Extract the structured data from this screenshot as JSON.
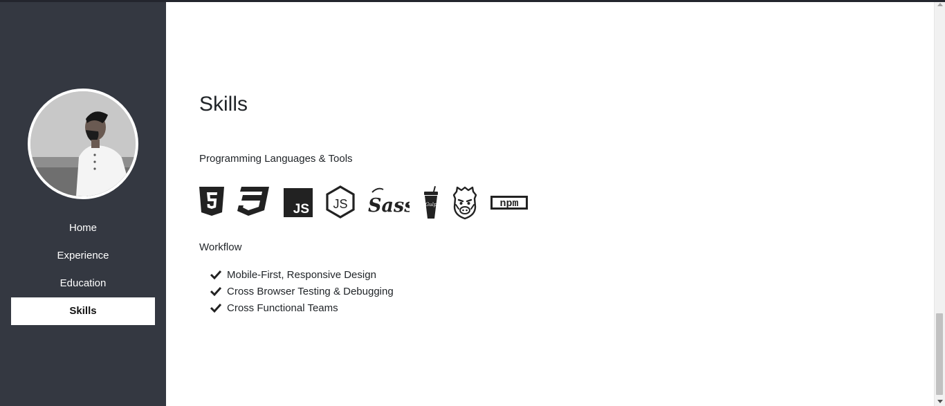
{
  "nav": {
    "items": [
      {
        "label": "Home"
      },
      {
        "label": "Experience"
      },
      {
        "label": "Education"
      },
      {
        "label": "Skills"
      }
    ],
    "active": "Skills"
  },
  "skills": {
    "title": "Skills",
    "tools_heading": "Programming Languages & Tools",
    "tools": [
      {
        "icon": "html5-icon",
        "gulp_label": ""
      },
      {
        "icon": "css3-icon"
      },
      {
        "icon": "javascript-icon",
        "label": "JS"
      },
      {
        "icon": "nodejs-icon",
        "label": "JS"
      },
      {
        "icon": "sass-icon",
        "label": "Sass"
      },
      {
        "icon": "gulp-icon",
        "label": "Gulp"
      },
      {
        "icon": "grunt-icon"
      },
      {
        "icon": "npm-icon",
        "label": "npm"
      }
    ],
    "workflow_heading": "Workflow",
    "workflow": [
      "Mobile-First, Responsive Design",
      "Cross Browser Testing & Debugging",
      "Cross Functional Teams"
    ]
  },
  "colors": {
    "sidebar": "#343841",
    "text": "#212529",
    "icon": "#222222"
  }
}
